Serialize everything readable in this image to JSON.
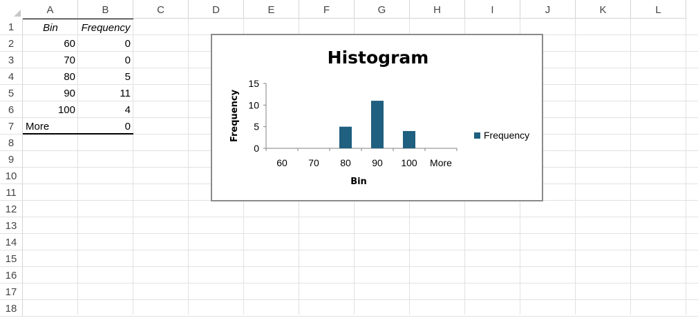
{
  "columns": [
    "A",
    "B",
    "C",
    "D",
    "E",
    "F",
    "G",
    "H",
    "I",
    "J",
    "K",
    "L"
  ],
  "rows": [
    "1",
    "2",
    "3",
    "4",
    "5",
    "6",
    "7",
    "8",
    "9",
    "10",
    "11",
    "12",
    "13",
    "14",
    "15",
    "16",
    "17",
    "18"
  ],
  "table": {
    "headers": [
      "Bin",
      "Frequency"
    ],
    "rows": [
      [
        "60",
        "0"
      ],
      [
        "70",
        "0"
      ],
      [
        "80",
        "5"
      ],
      [
        "90",
        "11"
      ],
      [
        "100",
        "4"
      ],
      [
        "More",
        "0"
      ]
    ]
  },
  "chart_data": {
    "type": "bar",
    "title": "Histogram",
    "xlabel": "Bin",
    "ylabel": "Frequency",
    "categories": [
      "60",
      "70",
      "80",
      "90",
      "100",
      "More"
    ],
    "series": [
      {
        "name": "Frequency",
        "values": [
          0,
          0,
          5,
          11,
          4,
          0
        ],
        "color": "#1f5f7f"
      }
    ],
    "ylim": [
      0,
      15
    ],
    "yticks": [
      "0",
      "5",
      "10",
      "15"
    ],
    "grid": false,
    "legend": "right"
  }
}
